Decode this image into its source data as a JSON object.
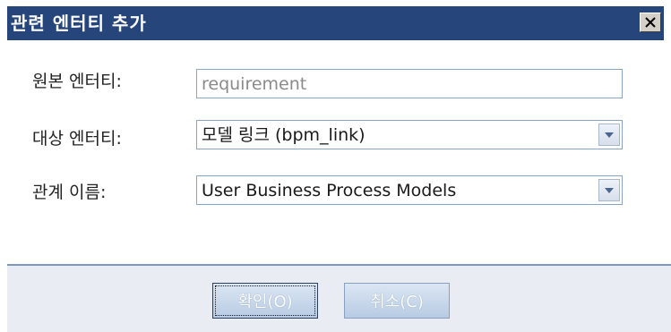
{
  "dialog": {
    "title": "관련 엔터티 추가",
    "close_icon": "close-icon",
    "fields": {
      "source": {
        "label": "원본 엔터티:",
        "value": "requirement"
      },
      "target": {
        "label": "대상 엔터티:",
        "value": "모델 링크 (bpm_link)"
      },
      "relation": {
        "label": "관계 이름:",
        "value": "User Business Process Models"
      }
    },
    "buttons": {
      "ok": "확인(O)",
      "cancel": "취소(C)"
    }
  },
  "colors": {
    "titlebar": "#26457b",
    "footer": "#e9edf3",
    "button": "#b8cbe3"
  }
}
